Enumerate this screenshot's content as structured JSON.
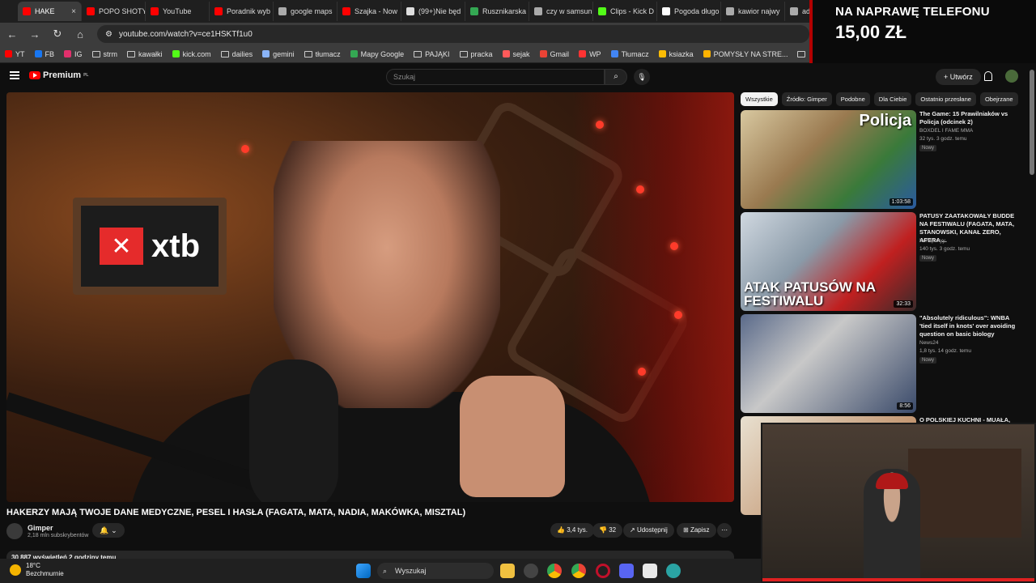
{
  "browser": {
    "tabs": [
      {
        "label": "HAKE",
        "color": "#ff0000",
        "active": true
      },
      {
        "label": "POPO SHOTY",
        "color": "#ff0000"
      },
      {
        "label": "YouTube",
        "color": "#ff0000"
      },
      {
        "label": "Poradnik wyb",
        "color": "#ff0000"
      },
      {
        "label": "google maps",
        "color": "#aaaaaa"
      },
      {
        "label": "Szajka - Now",
        "color": "#ff0000"
      },
      {
        "label": "(99+)Nie będ",
        "color": "#dddddd"
      },
      {
        "label": "Rusznikarska",
        "color": "#34a853"
      },
      {
        "label": "czy w samsun",
        "color": "#aaaaaa"
      },
      {
        "label": "Clips - Kick D",
        "color": "#53fc18"
      },
      {
        "label": "Pogoda długo",
        "color": "#ffffff"
      },
      {
        "label": "kawior najwy",
        "color": "#aaaaaa"
      },
      {
        "label": "ad poc",
        "color": "#aaaaaa"
      }
    ],
    "url": "youtube.com/watch?v=ce1HSKTf1u0",
    "bookmarks": [
      "YT",
      "FB",
      "IG",
      "strm",
      "kawałki",
      "kick.com",
      "dailies",
      "gemini",
      "tłumacz",
      "Mapy Google",
      "PAJĄKI",
      "pracka",
      "sejak",
      "Gmail",
      "WP",
      "Tłumacz",
      "ksiazka",
      "POMYSŁY NA STRE...",
      "bieżąco",
      "AD"
    ]
  },
  "overlay": {
    "line1": "NA NAPRAWĘ TELEFONU",
    "line2": "15,00 ZŁ"
  },
  "yt": {
    "logo": "Premium",
    "logo_sup": "PL",
    "search_placeholder": "Szukaj",
    "create_label": "+ Utwórz",
    "video_title": "HAKERZY MAJĄ TWOJE DANE MEDYCZNE, PESEL I HASŁA (FAGATA, MATA, NADIA, MAKÓWKA, MISZTAL)",
    "channel": "Gimper",
    "subscribers": "2,18 mln subskrybentów",
    "likes": "3,4 tys.",
    "dislikes": "32",
    "share": "Udostępnij",
    "save": "Zapisz",
    "views": "30 887 wyświetleń  2 godziny temu",
    "xtb": "xtb",
    "chips": [
      "Wszystkie",
      "Źródło: Gimper",
      "Podobne",
      "Dla Ciebie",
      "Ostatnio przesłane",
      "Obejrzane"
    ],
    "recommendations": [
      {
        "title": "The Game: 15 Prawilniaków vs Policja (odcinek 2)",
        "channel": "BOXDEL  I FAME MMA",
        "meta": "32 tys.   3 godz. temu",
        "badge": "Nowy",
        "duration": "1:03:58",
        "thumb_text": "Policja"
      },
      {
        "title": "PATUSY ZAATAKOWAŁY BUDDE NA FESTIWALU (FAGATA, MATA, STANOWSKI, KANAŁ ZERO, AFERA ...",
        "channel": "Konopskyy",
        "meta": "140 tys.   3 godz. temu",
        "badge": "Nowy",
        "duration": "32:33",
        "thumb_text": "ATAK PATUSÓW NA FESTIWALU"
      },
      {
        "title": "\"Absolutely ridiculous\": WNBA 'tied itself in knots' over avoiding question on basic biology",
        "channel": "News24",
        "meta": "1,8 tys.   14 godz. temu",
        "badge": "Nowy",
        "duration": "8:56",
        "thumb_text": ""
      },
      {
        "title": "O POLSKIEJ KUCHNI - MUAŁA,",
        "channel": "",
        "meta": "",
        "badge": "",
        "duration": "",
        "thumb_text": ""
      }
    ]
  },
  "taskbar": {
    "temp": "18°C",
    "weather": "Bezchmurnie",
    "search": "Wyszukaj"
  }
}
